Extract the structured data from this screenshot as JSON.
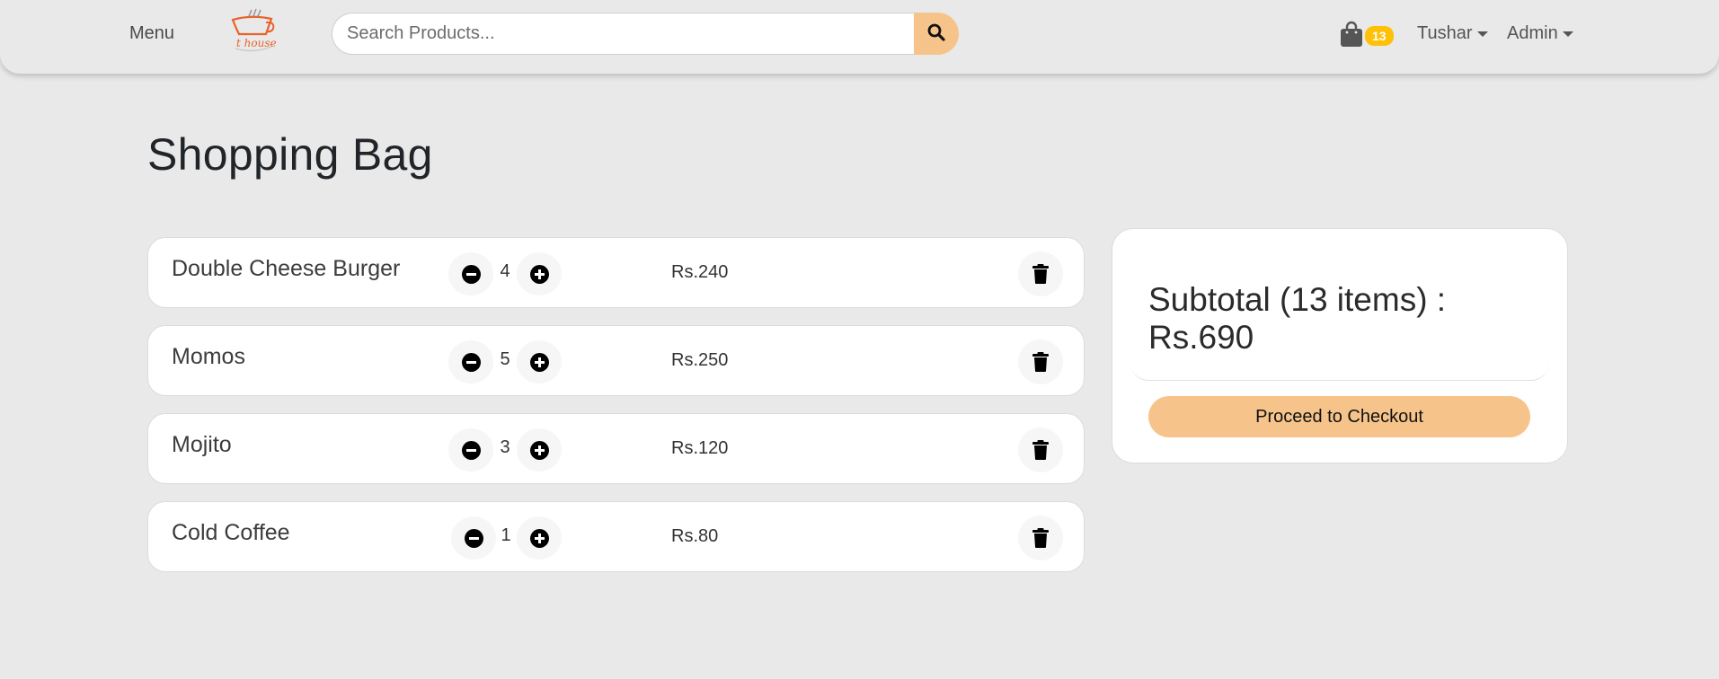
{
  "nav": {
    "menu_label": "Menu",
    "search_placeholder": "Search Products...",
    "cart_count": "13",
    "user_label": "Tushar",
    "admin_label": "Admin"
  },
  "page_title": "Shopping Bag",
  "items": [
    {
      "name": "Double Cheese Burger",
      "qty": "4",
      "price": "Rs.240"
    },
    {
      "name": "Momos",
      "qty": "5",
      "price": "Rs.250"
    },
    {
      "name": "Mojito",
      "qty": "3",
      "price": "Rs.120"
    },
    {
      "name": "Cold Coffee",
      "qty": "1",
      "price": "Rs.80"
    }
  ],
  "summary": {
    "subtotal_line1": "Subtotal (13 items) :",
    "subtotal_line2": "Rs.690",
    "checkout_label": "Proceed to Checkout"
  },
  "colors": {
    "accent": "#f6c48a",
    "badge": "#ffc107",
    "background": "#e9e9e9",
    "logo": "#e8632a"
  },
  "icons": {
    "search": "search-icon",
    "cart": "shopping-bag-icon",
    "minus": "minus-circle-icon",
    "plus": "plus-circle-icon",
    "delete": "trash-icon"
  }
}
